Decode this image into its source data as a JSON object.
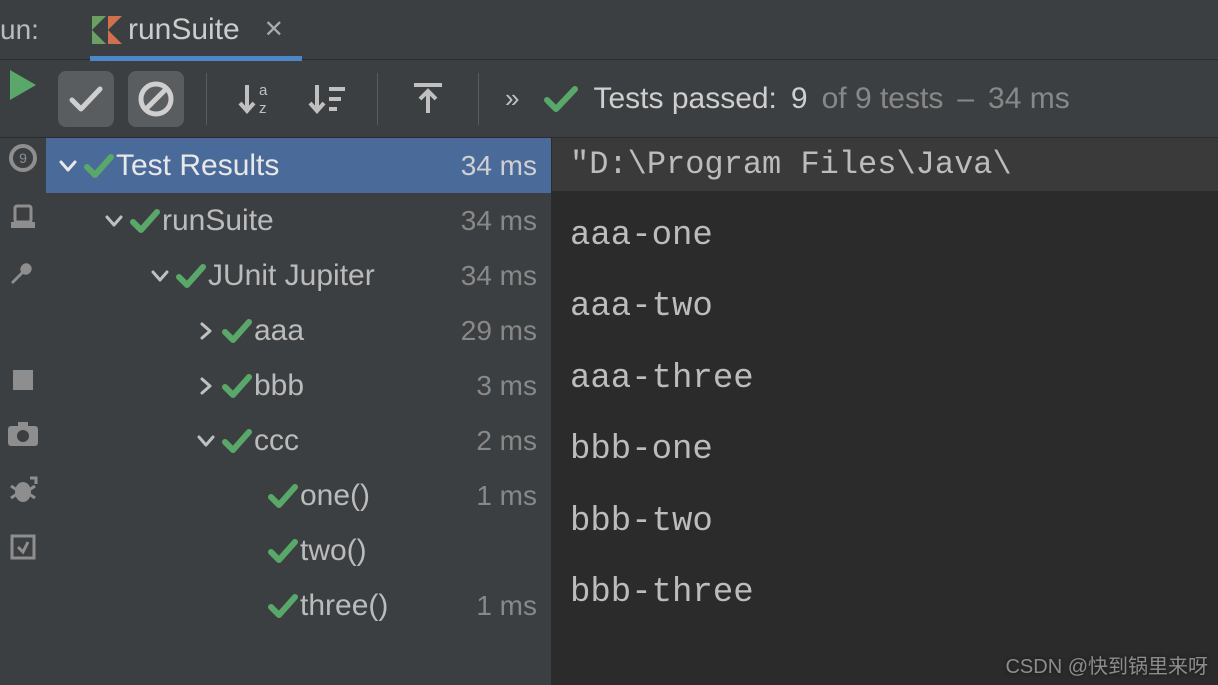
{
  "header": {
    "run_label": "un:",
    "tab_name": "runSuite"
  },
  "toolbar": {
    "status_prefix": "Tests passed:",
    "passed_count": "9",
    "status_mid": "of 9 tests",
    "status_dash": "–",
    "status_time": "34 ms"
  },
  "tree": [
    {
      "indent": 0,
      "chev": "down",
      "name": "Test Results",
      "time": "34 ms",
      "selected": true
    },
    {
      "indent": 1,
      "chev": "down",
      "name": "runSuite",
      "time": "34 ms",
      "selected": false
    },
    {
      "indent": 2,
      "chev": "down",
      "name": "JUnit Jupiter",
      "time": "34 ms",
      "selected": false
    },
    {
      "indent": 3,
      "chev": "right",
      "name": "aaa",
      "time": "29 ms",
      "selected": false
    },
    {
      "indent": 3,
      "chev": "right",
      "name": "bbb",
      "time": "3 ms",
      "selected": false
    },
    {
      "indent": 3,
      "chev": "down",
      "name": "ccc",
      "time": "2 ms",
      "selected": false
    },
    {
      "indent": 4,
      "chev": "",
      "name": "one()",
      "time": "1 ms",
      "selected": false
    },
    {
      "indent": 4,
      "chev": "",
      "name": "two()",
      "time": "",
      "selected": false
    },
    {
      "indent": 4,
      "chev": "",
      "name": "three()",
      "time": "1 ms",
      "selected": false
    }
  ],
  "console": {
    "command": "\"D:\\Program Files\\Java\\",
    "output": [
      "aaa-one",
      "aaa-two",
      "aaa-three",
      "bbb-one",
      "bbb-two",
      "bbb-three"
    ]
  },
  "watermark": "CSDN @快到锅里来呀"
}
